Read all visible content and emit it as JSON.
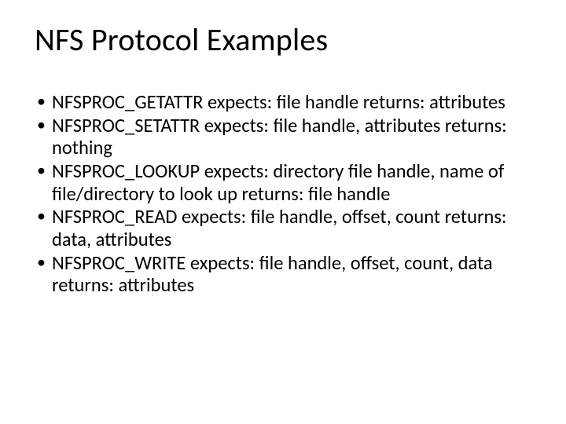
{
  "slide": {
    "title": "NFS Protocol Examples",
    "bullets": [
      "NFSPROC_GETATTR expects: file handle returns: attributes",
      "NFSPROC_SETATTR expects: file handle, attributes returns: nothing",
      "NFSPROC_LOOKUP expects: directory file handle, name of file/directory to look up returns: file handle",
      "NFSPROC_READ expects: file handle, offset, count returns: data, attributes",
      "NFSPROC_WRITE expects: file handle, offset, count, data returns: attributes"
    ]
  }
}
